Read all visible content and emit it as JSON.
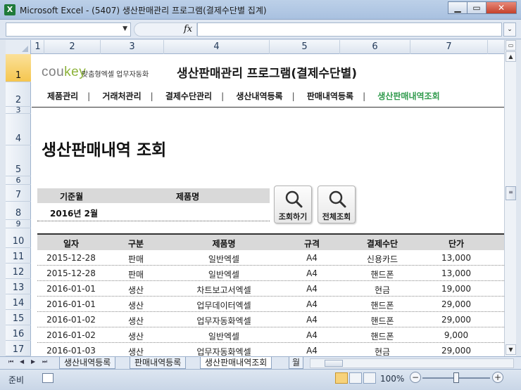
{
  "window": {
    "title": "Microsoft Excel - (5407) 생산판매관리 프로그램(결제수단별 집계)",
    "app_icon": "X"
  },
  "formula": {
    "fx": "fx"
  },
  "columns": [
    "1",
    "2",
    "3",
    "4",
    "5",
    "6",
    "7"
  ],
  "rows": [
    "1",
    "2",
    "3",
    "4",
    "5",
    "6",
    "7",
    "8",
    "9",
    "10",
    "11",
    "12",
    "13",
    "14",
    "15",
    "16",
    "17"
  ],
  "logo": {
    "brand_a": "cou",
    "brand_b": "key",
    "tagline": "맞춤형엑셀 업무자동화"
  },
  "program_title": "생산판매관리 프로그램(결제수단별)",
  "nav": [
    "제품관리",
    "거래처관리",
    "결제수단관리",
    "생산내역등록",
    "판매내역등록",
    "생산판매내역조회"
  ],
  "nav_active_index": 5,
  "page_title": "생산판매내역 조회",
  "search": {
    "month_label": "기준월",
    "product_label": "제품명",
    "month_value": "2016년 2월",
    "product_value": "",
    "search_button": "조회하기",
    "all_button": "전체조회"
  },
  "table": {
    "headers": [
      "일자",
      "구분",
      "제품명",
      "규격",
      "결제수단",
      "단가"
    ],
    "rows": [
      [
        "2015-12-28",
        "판매",
        "일반엑셀",
        "A4",
        "신용카드",
        "13,000"
      ],
      [
        "2015-12-28",
        "판매",
        "일반엑셀",
        "A4",
        "핸드폰",
        "13,000"
      ],
      [
        "2016-01-01",
        "생산",
        "차트보고서엑셀",
        "A4",
        "현금",
        "19,000"
      ],
      [
        "2016-01-01",
        "생산",
        "업무데이터엑셀",
        "A4",
        "핸드폰",
        "29,000"
      ],
      [
        "2016-01-02",
        "생산",
        "업무자동화엑셀",
        "A4",
        "핸드폰",
        "29,000"
      ],
      [
        "2016-01-02",
        "생산",
        "일반엑셀",
        "A4",
        "핸드폰",
        "9,000"
      ],
      [
        "2016-01-03",
        "생산",
        "업무자동화엑셀",
        "A4",
        "현금",
        "29,000"
      ]
    ]
  },
  "sheet_tabs": [
    "생산내역등록",
    "판매내역등록",
    "생산판매내역조회",
    "월"
  ],
  "active_sheet_index": 2,
  "status": {
    "ready": "준비",
    "zoom": "100%"
  },
  "colors": {
    "accent_green": "#2f9a4c",
    "logo_green": "#8db33a",
    "header_gray": "#d9d9d9"
  }
}
